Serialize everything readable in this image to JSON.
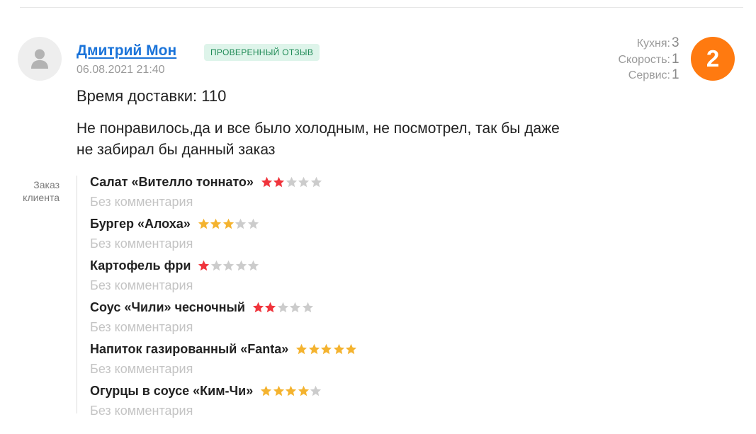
{
  "review": {
    "author": "Дмитрий Мон",
    "badge": "ПРОВЕРЕННЫЙ ОТЗЫВ",
    "date": "06.08.2021 21:40",
    "delivery_time": "Время доставки: 110",
    "text": "Не понравилось,да и все было холодным, не посмотрел, так бы даже не забирал бы данный заказ",
    "overall_score": "2",
    "scores": [
      {
        "label": "Кухня:",
        "value": "3"
      },
      {
        "label": "Скорость:",
        "value": "1"
      },
      {
        "label": "Сервис:",
        "value": "1"
      }
    ]
  },
  "order": {
    "label": "Заказ клиента",
    "items": [
      {
        "name": "Салат «Вителло тоннато»",
        "rating": 2,
        "max": 5,
        "comment": "Без комментария"
      },
      {
        "name": "Бургер «Алоха»",
        "rating": 3,
        "max": 5,
        "comment": "Без комментария"
      },
      {
        "name": "Картофель фри",
        "rating": 1,
        "max": 5,
        "comment": "Без комментария"
      },
      {
        "name": "Соус «Чили» чесночный",
        "rating": 2,
        "max": 5,
        "comment": "Без комментария"
      },
      {
        "name": "Напиток газированный «Fanta»",
        "rating": 5,
        "max": 5,
        "comment": "Без комментария"
      },
      {
        "name": "Огурцы в соусе «Ким-Чи»",
        "rating": 4,
        "max": 5,
        "comment": "Без комментария"
      }
    ]
  },
  "colors": {
    "link": "#1a73d9",
    "badge_bg": "#def4ea",
    "badge_text": "#1e8a55",
    "overall_badge": "#ff7a10",
    "star_low": "#f0343c",
    "star_high": "#f4b32f",
    "star_empty": "#cccccc"
  },
  "icons": {
    "avatar": "user-silhouette-icon",
    "star": "star-icon"
  }
}
